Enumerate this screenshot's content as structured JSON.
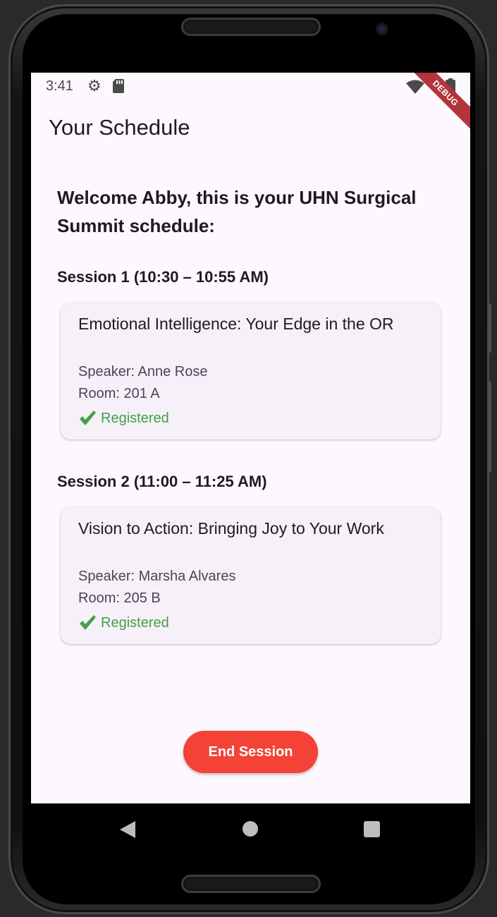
{
  "status_bar": {
    "time": "3:41",
    "icons": [
      "gear-icon",
      "sd-card-icon",
      "wifi-icon",
      "battery-icon"
    ]
  },
  "debug_banner": "DEBUG",
  "app_bar": {
    "title": "Your Schedule"
  },
  "welcome_text": "Welcome Abby, this is your UHN Surgical Summit schedule:",
  "sessions": [
    {
      "heading": "Session 1 (10:30 – 10:55 AM)",
      "title": "Emotional Intelligence: Your Edge in the OR",
      "speaker": "Speaker: Anne Rose",
      "room": "Room: 201 A",
      "status": "Registered"
    },
    {
      "heading": "Session 2 (11:00 – 11:25 AM)",
      "title": "Vision to Action: Bringing Joy to Your Work",
      "speaker": "Speaker: Marsha Alvares",
      "room": "Room: 205 B",
      "status": "Registered"
    }
  ],
  "end_button_label": "End Session",
  "colors": {
    "screen_background": "#fdf7fe",
    "card_background": "#f6f1f8",
    "registered_green": "#43a047",
    "end_button_red": "#f44336",
    "debug_banner": "#b3343a"
  }
}
